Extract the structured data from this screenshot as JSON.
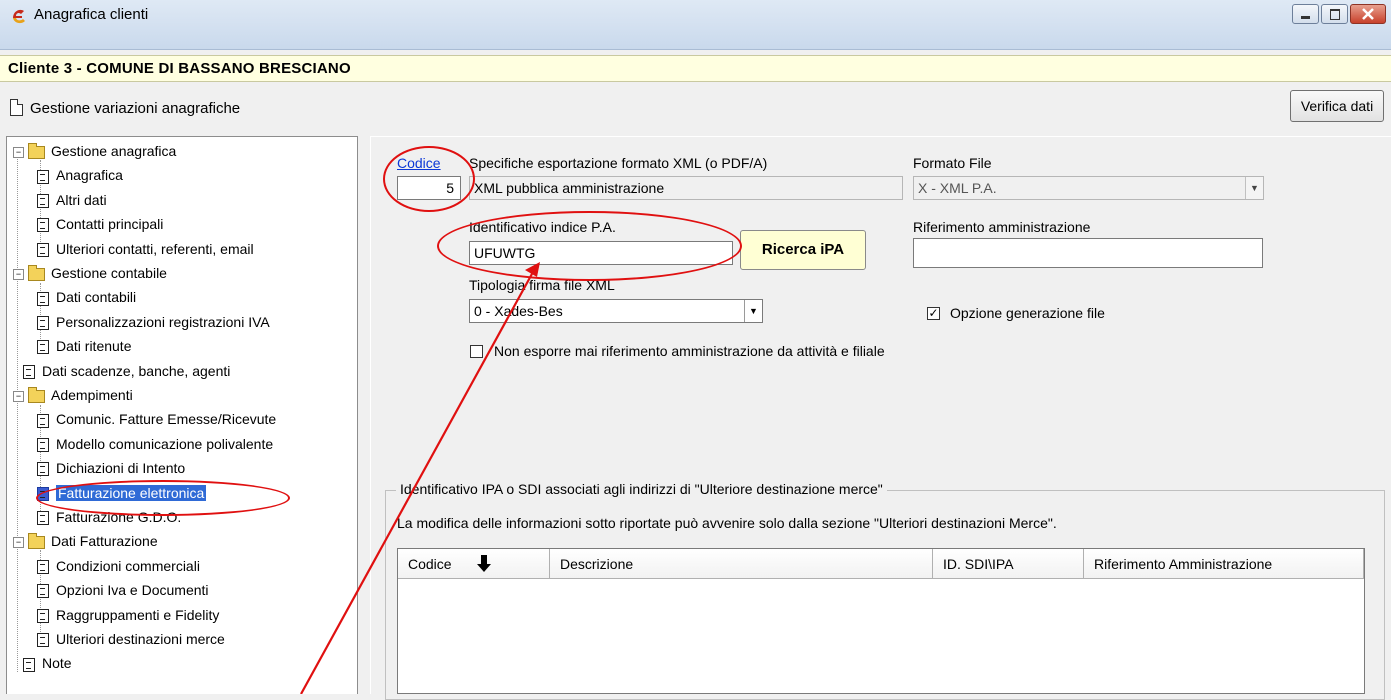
{
  "window": {
    "title": "Anagrafica clienti"
  },
  "client_bar": {
    "text": "Cliente 3 - COMUNE DI BASSANO BRESCIANO"
  },
  "toolbar": {
    "variations_label": "Gestione variazioni anagrafiche",
    "verify_button": "Verifica dati"
  },
  "tree": {
    "nodes": [
      {
        "label": "Gestione anagrafica",
        "type": "folder",
        "level": 0
      },
      {
        "label": "Anagrafica",
        "type": "page",
        "level": 1
      },
      {
        "label": "Altri dati",
        "type": "page",
        "level": 1
      },
      {
        "label": "Contatti principali",
        "type": "page",
        "level": 1
      },
      {
        "label": "Ulteriori contatti, referenti, email",
        "type": "page",
        "level": 1
      },
      {
        "label": "Gestione contabile",
        "type": "folder",
        "level": 0
      },
      {
        "label": "Dati contabili",
        "type": "page",
        "level": 1
      },
      {
        "label": "Personalizzazioni registrazioni IVA",
        "type": "page",
        "level": 1
      },
      {
        "label": "Dati ritenute",
        "type": "page",
        "level": 1
      },
      {
        "label": "Dati scadenze, banche, agenti",
        "type": "page",
        "level": 0
      },
      {
        "label": "Adempimenti",
        "type": "folder",
        "level": 0
      },
      {
        "label": "Comunic. Fatture Emesse/Ricevute",
        "type": "page",
        "level": 1
      },
      {
        "label": "Modello comunicazione polivalente",
        "type": "page",
        "level": 1
      },
      {
        "label": "Dichiazioni di Intento",
        "type": "page",
        "level": 1
      },
      {
        "label": "Fatturazione elettronica",
        "type": "page",
        "level": 1,
        "selected": true
      },
      {
        "label": "Fatturazione G.D.O.",
        "type": "page",
        "level": 1
      },
      {
        "label": "Dati Fatturazione",
        "type": "folder",
        "level": 0
      },
      {
        "label": "Condizioni commerciali",
        "type": "page",
        "level": 1
      },
      {
        "label": "Opzioni Iva e Documenti",
        "type": "page",
        "level": 1
      },
      {
        "label": "Raggruppamenti e Fidelity",
        "type": "page",
        "level": 1
      },
      {
        "label": "Ulteriori destinazioni merce",
        "type": "page",
        "level": 1
      },
      {
        "label": "Note",
        "type": "page",
        "level": 0
      }
    ]
  },
  "form": {
    "codice_label": "Codice",
    "codice_value": "5",
    "spec_label": "Specifiche esportazione formato XML (o PDF/A)",
    "spec_value": "XML pubblica amministrazione",
    "formato_label": "Formato File",
    "formato_value": "X - XML P.A.",
    "ipa_label": "Identificativo indice P.A.",
    "ipa_value": "UFUWTG",
    "ricerca_button": "Ricerca iPA",
    "rif_label": "Riferimento amministrazione",
    "rif_value": "",
    "firma_label": "Tipologia firma file XML",
    "firma_value": "0 - Xades-Bes",
    "opzione_label": "Opzione generazione file",
    "opzione_checked": true,
    "non_esporre_label": "Non esporre mai riferimento amministrazione da attività e filiale",
    "non_esporre_checked": false
  },
  "group": {
    "title": "Identificativo IPA o SDI associati agli indirizzi di \"Ulteriore destinazione merce\"",
    "note": "La modifica delle informazioni sotto riportate può avvenire solo dalla sezione \"Ulteriori destinazioni Merce\".",
    "columns": [
      "Codice",
      "Descrizione",
      "ID. SDI\\IPA",
      "Riferimento Amministrazione"
    ]
  },
  "colors": {
    "annotation": "#e01010",
    "client_bar_bg": "#ffffe0",
    "selection": "#2f6ad6",
    "link": "#0b37d6"
  }
}
